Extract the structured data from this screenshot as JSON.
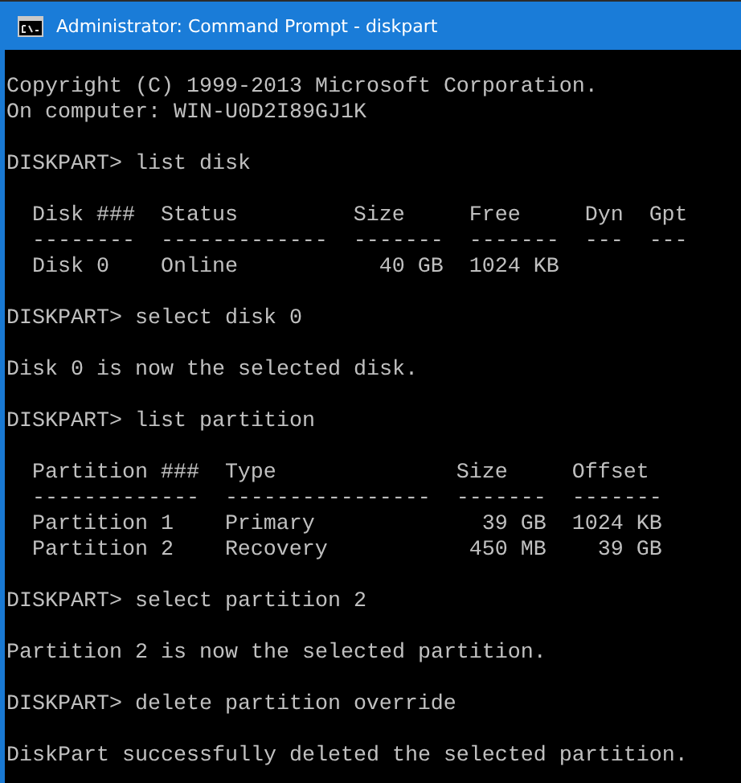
{
  "window": {
    "title": "Administrator: Command Prompt - diskpart"
  },
  "console": [
    {
      "kind": "blank"
    },
    {
      "kind": "output",
      "text": "Copyright (C) 1999-2013 Microsoft Corporation."
    },
    {
      "kind": "output",
      "text": "On computer: WIN-U0D2I89GJ1K"
    },
    {
      "kind": "blank"
    },
    {
      "kind": "prompt",
      "prompt": "DISKPART>",
      "command": "list disk"
    },
    {
      "kind": "blank"
    },
    {
      "kind": "table",
      "columns": [
        {
          "heading": "Disk ###",
          "rule": "--------",
          "numeric": false
        },
        {
          "heading": "Status",
          "rule": "-------------",
          "numeric": false
        },
        {
          "heading": "Size",
          "rule": "-------",
          "numeric": true
        },
        {
          "heading": "Free",
          "rule": "-------"
        },
        {
          "heading": "Dyn",
          "rule": "---"
        },
        {
          "heading": "Gpt",
          "rule": "---"
        }
      ],
      "rows": [
        [
          "Disk 0",
          "Online",
          "40 GB",
          "1024 KB"
        ]
      ]
    },
    {
      "kind": "blank"
    },
    {
      "kind": "prompt",
      "prompt": "DISKPART>",
      "command": "select disk 0"
    },
    {
      "kind": "blank"
    },
    {
      "kind": "output",
      "text": "Disk 0 is now the selected disk."
    },
    {
      "kind": "blank"
    },
    {
      "kind": "prompt",
      "prompt": "DISKPART>",
      "command": "list partition"
    },
    {
      "kind": "blank"
    },
    {
      "kind": "table",
      "columns": [
        {
          "heading": "Partition ###",
          "rule": "-------------",
          "numeric": false
        },
        {
          "heading": "Type",
          "rule": "----------------",
          "numeric": false
        },
        {
          "heading": "Size",
          "rule": "-------",
          "numeric": true
        },
        {
          "heading": "Offset",
          "rule": "-------",
          "numeric": true
        }
      ],
      "rows": [
        [
          "Partition 1",
          "Primary",
          "39 GB",
          "1024 KB"
        ],
        [
          "Partition 2",
          "Recovery",
          "450 MB",
          "39 GB"
        ]
      ]
    },
    {
      "kind": "blank"
    },
    {
      "kind": "prompt",
      "prompt": "DISKPART>",
      "command": "select partition 2"
    },
    {
      "kind": "blank"
    },
    {
      "kind": "output",
      "text": "Partition 2 is now the selected partition."
    },
    {
      "kind": "blank"
    },
    {
      "kind": "prompt",
      "prompt": "DISKPART>",
      "command": "delete partition override"
    },
    {
      "kind": "blank"
    },
    {
      "kind": "output",
      "text": "DiskPart successfully deleted the selected partition."
    }
  ]
}
